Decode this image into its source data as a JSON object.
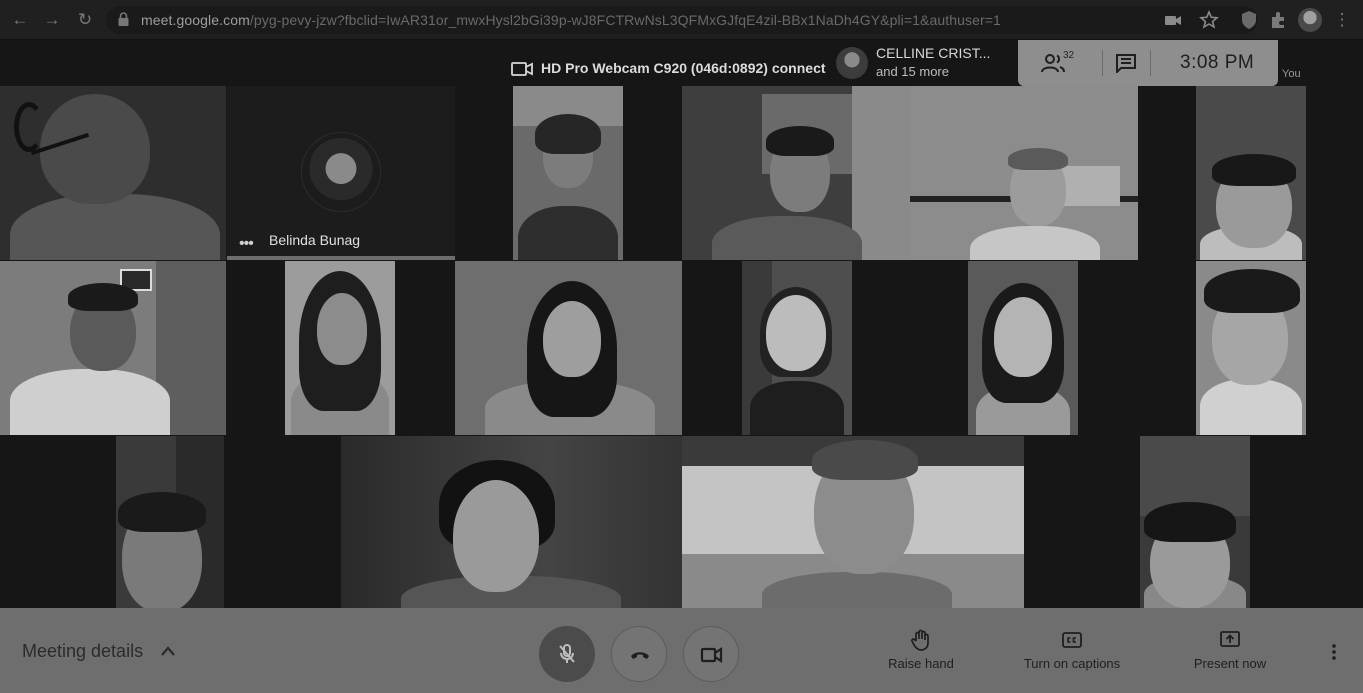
{
  "browser": {
    "url_host": "meet.google.com",
    "url_path": "/pyg-pevy-jzw?fbclid=IwAR31or_mwxHysl2bGi39p-wJ8FCTRwNsL3QFMxGJfqE4zil-BBx1NaDh4GY&pli=1&authuser=1"
  },
  "banner": {
    "device_text": "HD Pro Webcam C920 (046d:0892)  connect"
  },
  "presenter": {
    "name": "CELLINE CRIST...",
    "others": "and 15 more"
  },
  "topbar": {
    "participant_count": "32",
    "time": "3:08  PM"
  },
  "self_label": "You",
  "tiles": [
    {
      "id": "t1",
      "tone": "#3a3a3a"
    },
    {
      "id": "t2",
      "tone": "#1c1c1c",
      "name": "Belinda Bunag"
    },
    {
      "id": "t3",
      "tone": "#6a6a6a"
    },
    {
      "id": "t4",
      "tone": "#4a4a4a"
    },
    {
      "id": "t5",
      "tone": "#7a7a7a"
    },
    {
      "id": "t6",
      "tone": "#5a5a5a"
    },
    {
      "id": "t7",
      "tone": "#7e7e7e"
    },
    {
      "id": "t8",
      "tone": "#9a9a9a"
    },
    {
      "id": "t9",
      "tone": "#5e5e5e"
    },
    {
      "id": "t10",
      "tone": "#4e4e4e"
    },
    {
      "id": "t11",
      "tone": "#6e6e6e"
    },
    {
      "id": "t12",
      "tone": "#8c8c8c"
    },
    {
      "id": "t13",
      "tone": "#3e3e3e"
    },
    {
      "id": "t14",
      "tone": "#3a3a3a"
    },
    {
      "id": "t15",
      "tone": "#bdbdbd"
    },
    {
      "id": "t16",
      "tone": "#505050"
    }
  ],
  "bottom": {
    "meeting_details": "Meeting details",
    "raise_hand": "Raise hand",
    "captions": "Turn on captions",
    "present": "Present now"
  },
  "icons": {
    "mic": "mic-off-icon",
    "hangup": "phone-hangup-icon",
    "camera": "videocam-icon",
    "people": "people-icon",
    "chat": "chat-icon",
    "hand": "hand-icon",
    "captions": "closed-captions-icon",
    "present": "present-screen-icon",
    "more": "more-vert-icon"
  }
}
